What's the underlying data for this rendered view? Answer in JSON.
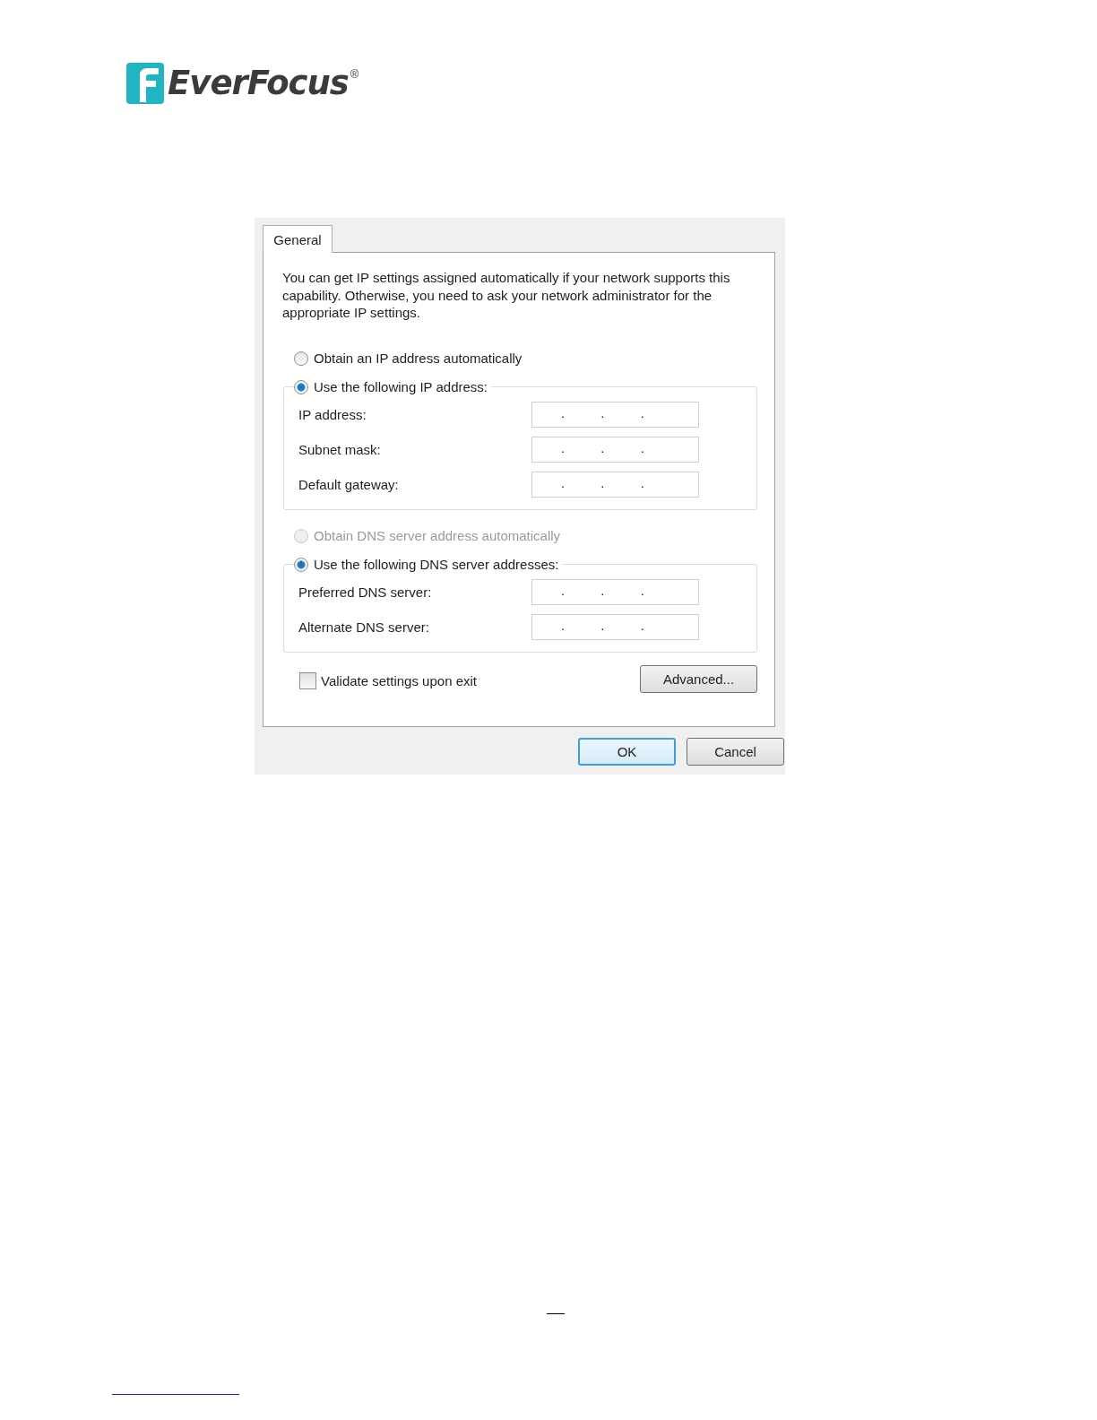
{
  "logo": {
    "brand": "EverFocus",
    "mark": "®"
  },
  "dialog": {
    "tabs": [
      {
        "label": "General",
        "selected": true
      }
    ],
    "intro": "You can get IP settings assigned automatically if your network supports this capability. Otherwise, you need to ask your network administrator for the appropriate IP settings.",
    "ip_options": [
      {
        "label": "Obtain an IP address automatically",
        "selected": false,
        "disabled": false
      },
      {
        "label": "Use the following IP address:",
        "selected": true,
        "disabled": false
      }
    ],
    "ip_fields": [
      {
        "label": "IP address:",
        "value": ". . ."
      },
      {
        "label": "Subnet mask:",
        "value": ". . ."
      },
      {
        "label": "Default gateway:",
        "value": ". . ."
      }
    ],
    "dns_options": [
      {
        "label": "Obtain DNS server address automatically",
        "selected": false,
        "disabled": true
      },
      {
        "label": "Use the following DNS server addresses:",
        "selected": true,
        "disabled": false
      }
    ],
    "dns_fields": [
      {
        "label": "Preferred DNS server:",
        "value": ". . ."
      },
      {
        "label": "Alternate DNS server:",
        "value": ". . ."
      }
    ],
    "validate": {
      "label": "Validate settings upon exit",
      "checked": false
    },
    "advanced_button": "Advanced...",
    "buttons": [
      {
        "label": "OK",
        "default": true
      },
      {
        "label": "Cancel",
        "default": false
      }
    ]
  }
}
